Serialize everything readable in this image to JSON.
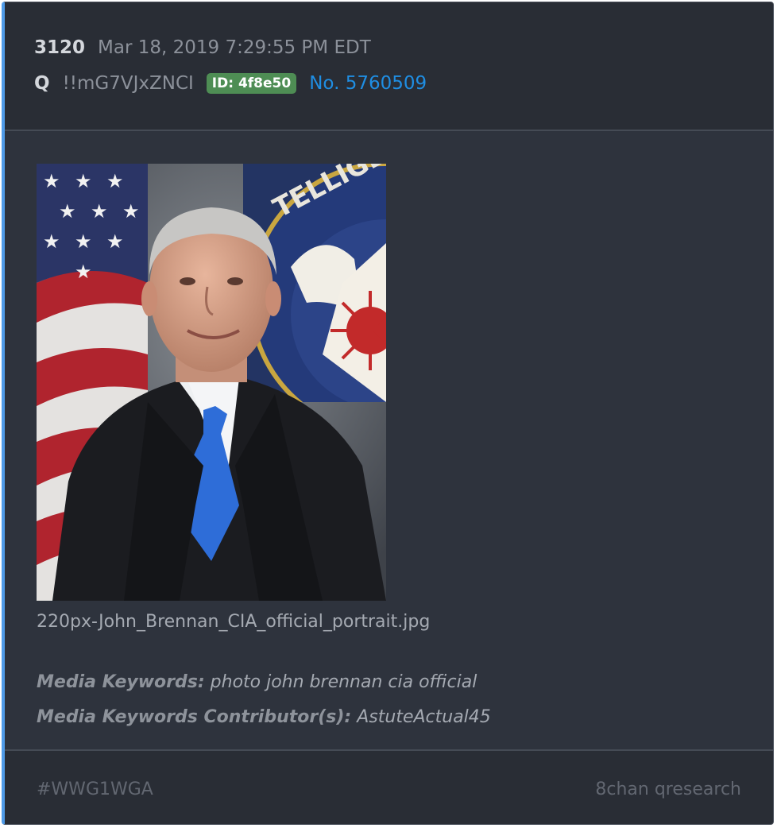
{
  "post": {
    "number": "3120",
    "datetime": "Mar 18, 2019 7:29:55 PM EDT",
    "author": "Q",
    "tripcode": "!!mG7VJxZNCI",
    "id_badge": "ID: 4f8e50",
    "post_link": "No. 5760509"
  },
  "media": {
    "filename": "220px-John_Brennan_CIA_official_portrait.jpg",
    "seal_text": "TELLIGENCE A"
  },
  "keywords": {
    "label": "Media Keywords:",
    "value": "photo john brennan cia official",
    "contributor_label": "Media Keywords Contributor(s):",
    "contributor_value": "AstuteActual45"
  },
  "footer": {
    "hashtag": "#WWG1WGA",
    "source": "8chan qresearch"
  },
  "colors": {
    "card_bg": "#2e333d",
    "header_bg": "#292d35",
    "accent_border": "#4f9be8",
    "link": "#1f8ee3",
    "id_badge": "#4e8d54"
  }
}
